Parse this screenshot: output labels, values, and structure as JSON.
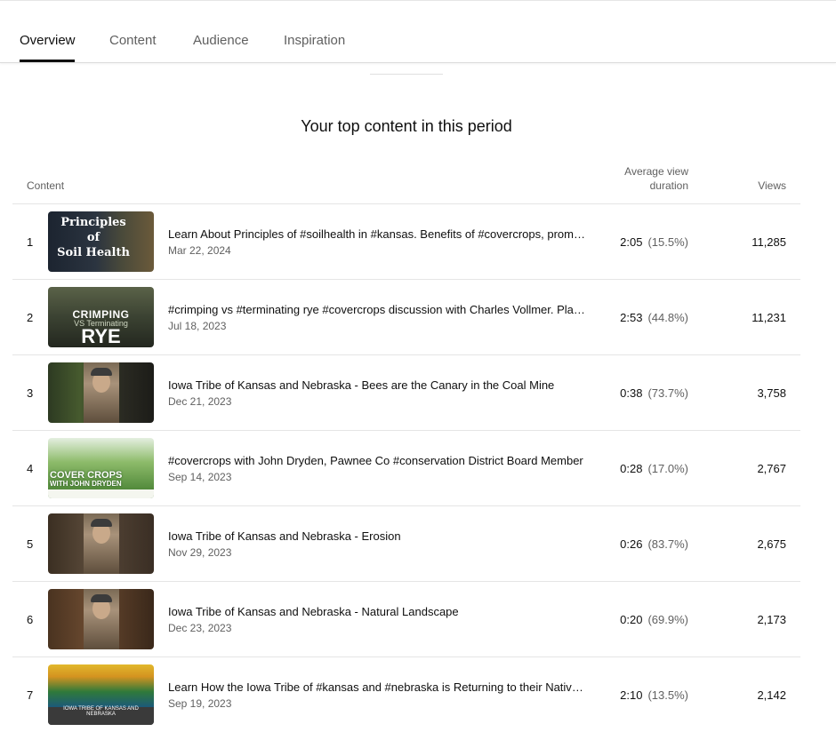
{
  "tabs": [
    {
      "label": "Overview",
      "active": true
    },
    {
      "label": "Content",
      "active": false
    },
    {
      "label": "Audience",
      "active": false
    },
    {
      "label": "Inspiration",
      "active": false
    }
  ],
  "section_title": "Your top content in this period",
  "columns": {
    "content": "Content",
    "duration_line1": "Average view",
    "duration_line2": "duration",
    "views": "Views"
  },
  "rows": [
    {
      "rank": "1",
      "title": "Learn About Principles of #soilhealth in #kansas. Benefits of #covercrops, promoting biodiversity",
      "date": "Mar 22, 2024",
      "duration": "2:05",
      "percent": "(15.5%)",
      "views": "11,285",
      "thumb_text": [
        "Principles",
        "of",
        "Soil Health"
      ]
    },
    {
      "rank": "2",
      "title": "#crimping vs #terminating rye #covercrops discussion with Charles Vollmer. Planting green",
      "date": "Jul 18, 2023",
      "duration": "2:53",
      "percent": "(44.8%)",
      "views": "11,231",
      "thumb_text": [
        "CRIMPING",
        "VS Terminating",
        "RYE"
      ]
    },
    {
      "rank": "3",
      "title": "Iowa Tribe of Kansas and Nebraska - Bees are the Canary in the Coal Mine",
      "date": "Dec 21, 2023",
      "duration": "0:38",
      "percent": "(73.7%)",
      "views": "3,758"
    },
    {
      "rank": "4",
      "title": "#covercrops with John Dryden, Pawnee Co #conservation District Board Member",
      "date": "Sep 14, 2023",
      "duration": "0:28",
      "percent": "(17.0%)",
      "views": "2,767",
      "thumb_text": [
        "COVER CROPS",
        "WITH JOHN DRYDEN"
      ]
    },
    {
      "rank": "5",
      "title": "Iowa Tribe of Kansas and Nebraska - Erosion",
      "date": "Nov 29, 2023",
      "duration": "0:26",
      "percent": "(83.7%)",
      "views": "2,675"
    },
    {
      "rank": "6",
      "title": "Iowa Tribe of Kansas and Nebraska - Natural Landscape",
      "date": "Dec 23, 2023",
      "duration": "0:20",
      "percent": "(69.9%)",
      "views": "2,173"
    },
    {
      "rank": "7",
      "title": "Learn How the Iowa Tribe of #kansas and #nebraska is Returning to their Native Landscape",
      "date": "Sep 19, 2023",
      "duration": "2:10",
      "percent": "(13.5%)",
      "views": "2,142",
      "thumb_text": [
        "IOWA TRIBE OF KANSAS AND NEBRASKA"
      ]
    }
  ]
}
